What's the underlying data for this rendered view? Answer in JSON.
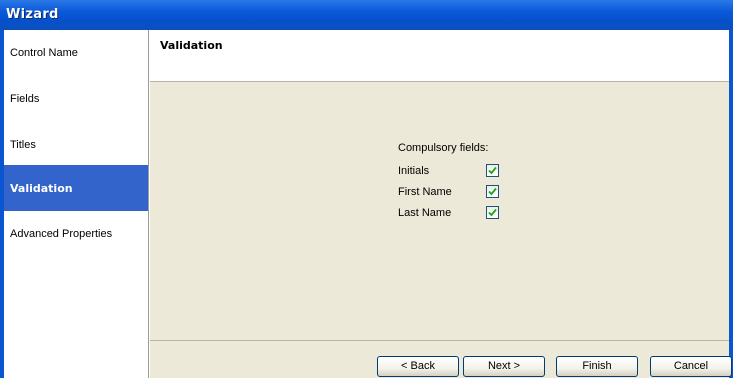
{
  "window": {
    "title": "Wizard"
  },
  "sidebar": {
    "items": [
      {
        "label": "Control Name",
        "selected": false
      },
      {
        "label": "Fields",
        "selected": false
      },
      {
        "label": "Titles",
        "selected": false
      },
      {
        "label": "Validation",
        "selected": true
      },
      {
        "label": "Advanced Properties",
        "selected": false
      }
    ]
  },
  "page": {
    "title": "Validation",
    "group_label": "Compulsory fields:",
    "fields": [
      {
        "label": "Initials",
        "checked": true
      },
      {
        "label": "First Name",
        "checked": true
      },
      {
        "label": "Last Name",
        "checked": true
      }
    ]
  },
  "footer": {
    "back_label": "< Back",
    "next_label": "Next >",
    "finish_label": "Finish",
    "cancel_label": "Cancel"
  },
  "colors": {
    "titlebar": "#0a58d8",
    "selected_item": "#3264cc",
    "panel_bg": "#ece9d8",
    "checkmark": "#21a121"
  }
}
